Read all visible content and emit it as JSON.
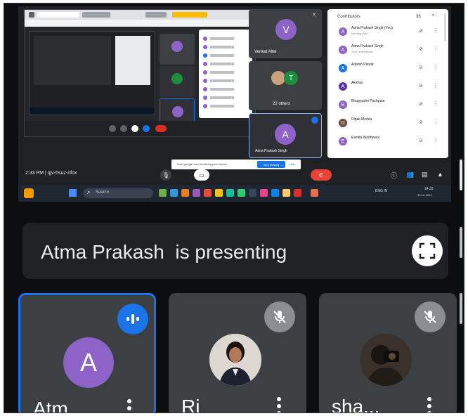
{
  "presenter_name": "Atma Prakash",
  "presenting_suffix": "is presenting",
  "shared_screen": {
    "nested_tab_title": "Meet - kgv-hsuz-nfor",
    "side_tiles": {
      "top": {
        "initial": "V",
        "name": "Venkat Alter",
        "color": "#8e63c7"
      },
      "middle": {
        "initial": "T",
        "label": "22 others",
        "color": "#1e8e3e"
      },
      "bottom": {
        "initial": "A",
        "name": "Atma Prakash Singh",
        "color": "#8e63c7"
      }
    },
    "people_panel": {
      "title": "Contributors",
      "count": "36",
      "participants": [
        {
          "initial": "A",
          "name": "Atma Prakash Singh (You)",
          "sub": "Meeting host",
          "color": "#8e63c7"
        },
        {
          "initial": "A",
          "name": "Atma Prakash Singh",
          "sub": "Your presentation",
          "color": "#8e63c7"
        },
        {
          "initial": "A",
          "name": "Adarsh Pande",
          "sub": "",
          "color": "#1a73e8"
        },
        {
          "initial": "A",
          "name": "Akshay",
          "sub": "",
          "color": "#5e35b1"
        },
        {
          "initial": "B",
          "name": "Bhagyashri Pachpute",
          "sub": "",
          "color": "#8e63c7"
        },
        {
          "initial": "D",
          "name": "Dipak Mishra",
          "sub": "",
          "color": "#6d4c41"
        },
        {
          "initial": "E",
          "name": "Esmita Wadhwani",
          "sub": "",
          "color": "#8e63c7"
        }
      ]
    },
    "notice": {
      "text": "meet.google.com is sharing your screen.",
      "stop": "Stop sharing",
      "hide": "Hide"
    },
    "meet_bar": {
      "time": "2:33 PM",
      "code": "qjv-hsuz-nfox"
    },
    "taskbar": {
      "search": "Search",
      "time": "14:33",
      "date": "30-12-2024",
      "lang": "ENG IN"
    }
  },
  "tiles": [
    {
      "name": "Atm...",
      "initial": "A",
      "avatar_color": "#8e63c7",
      "state": "speaking"
    },
    {
      "name": "Rj",
      "state": "muted",
      "has_photo": true
    },
    {
      "name": "sha...",
      "state": "muted",
      "has_photo": true
    }
  ],
  "icons": {
    "fullscreen": "fullscreen-icon",
    "speaking": "audio-level-icon",
    "muted": "mic-off-icon",
    "more": "more-vert-icon"
  }
}
